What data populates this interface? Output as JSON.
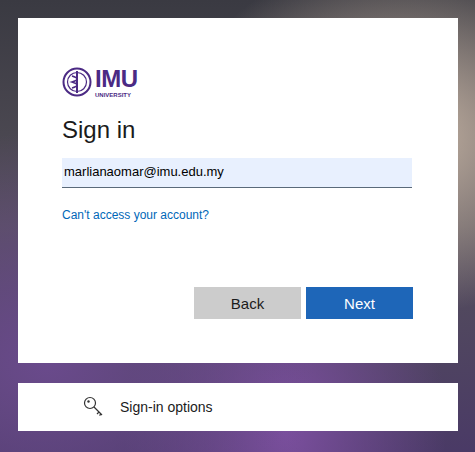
{
  "logo": {
    "name": "IMU",
    "subtitle": "UNIVERSITY"
  },
  "title": "Sign in",
  "email_field": {
    "value": "marlianaomar@imu.edu.my"
  },
  "link": "Can't access your account?",
  "buttons": [
    {
      "label": "Back",
      "kind": "secondary"
    },
    {
      "label": "Next",
      "kind": "primary"
    }
  ],
  "options": {
    "label": "Sign-in options"
  }
}
